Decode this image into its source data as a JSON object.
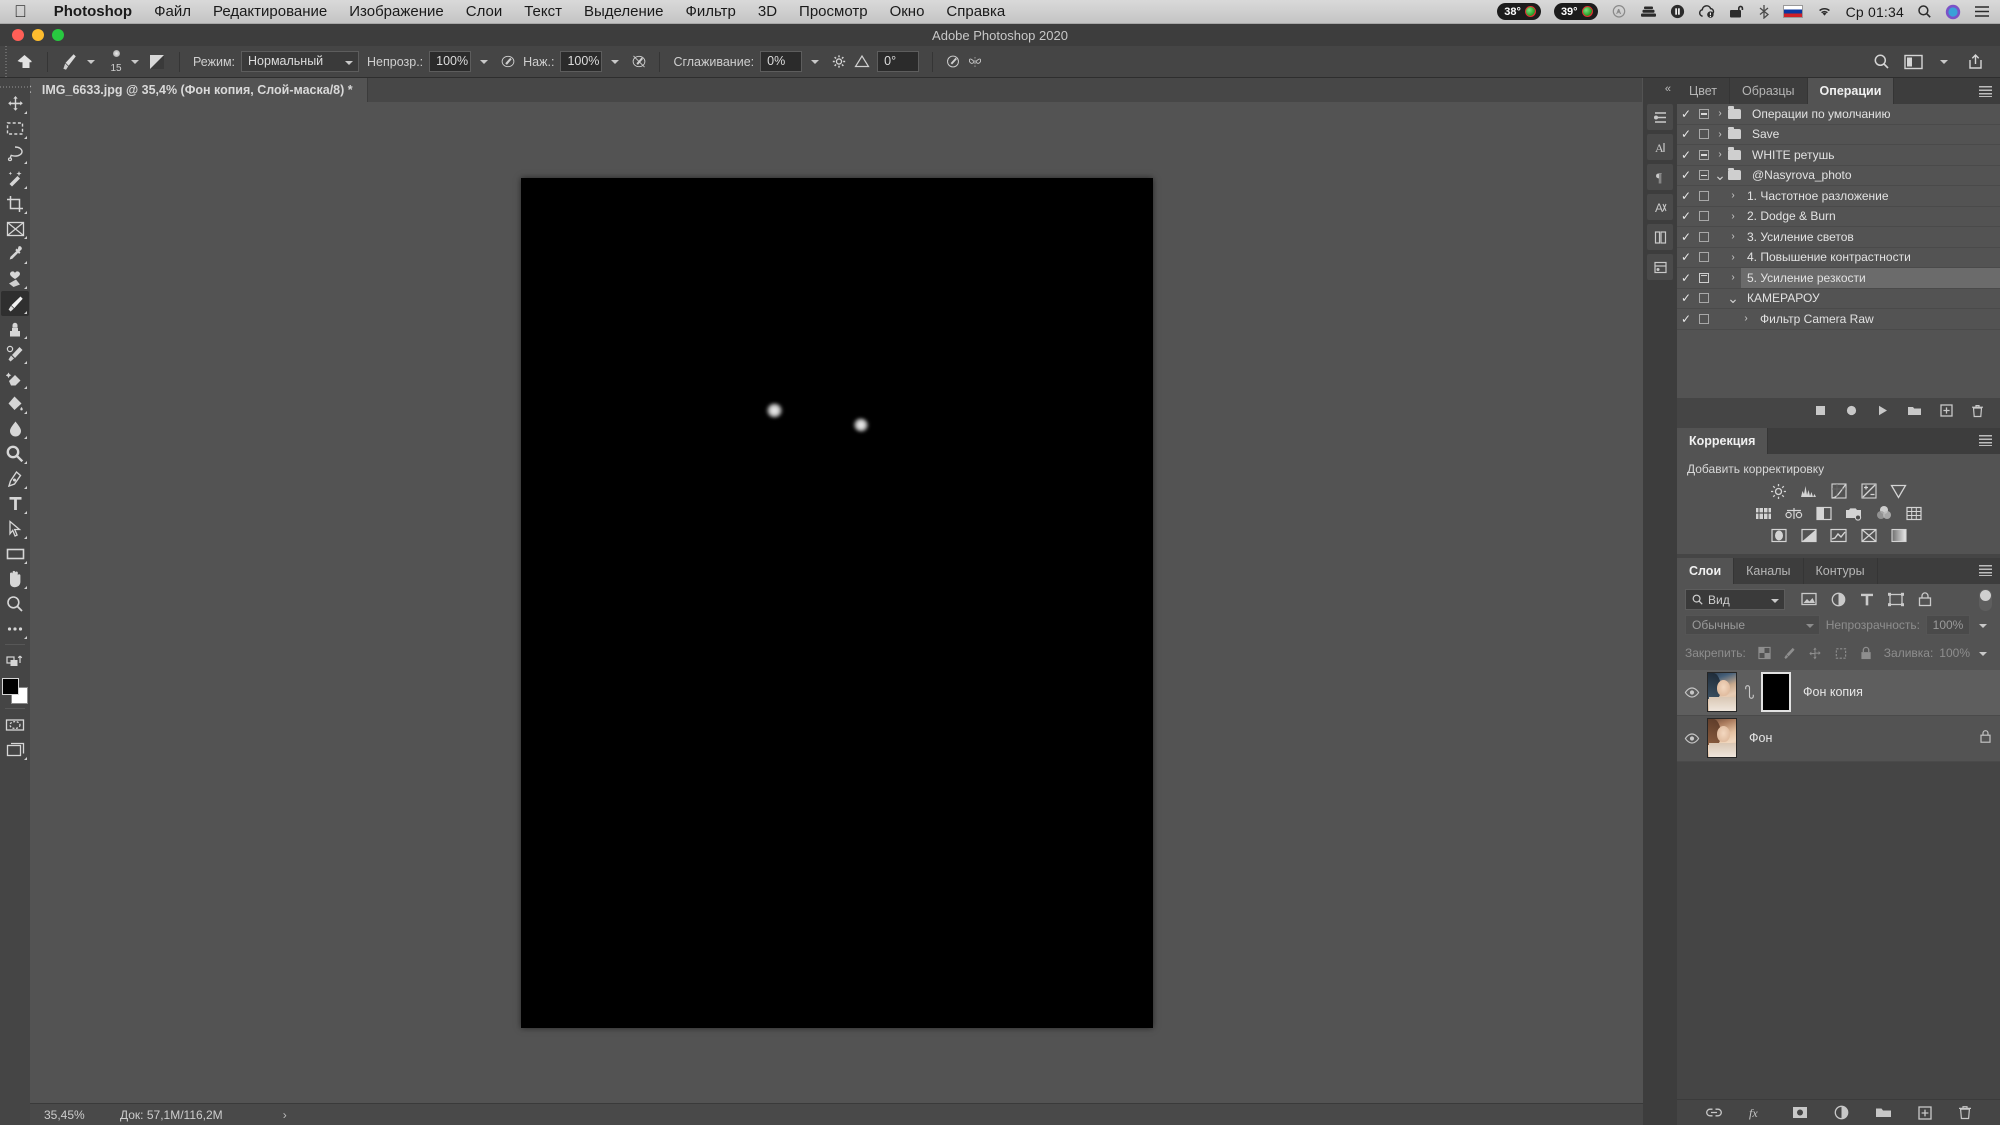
{
  "macmenu": {
    "apple_icon": "apple-logo-icon",
    "app_name": "Photoshop",
    "items": [
      "Файл",
      "Редактирование",
      "Изображение",
      "Слои",
      "Текст",
      "Выделение",
      "Фильтр",
      "3D",
      "Просмотр",
      "Окно",
      "Справка"
    ],
    "status": {
      "temp1": "38°",
      "temp2": "39°",
      "icons": [
        "creative-cloud-icon",
        "backup-icon",
        "dropbox-icon",
        "cloud-sync-icon",
        "vpn-icon",
        "bluetooth-icon"
      ],
      "flag": "russian-flag-icon",
      "wifi": "wifi-icon",
      "clock": "Ср 01:34",
      "search": "spotlight-search-icon",
      "siri": "siri-icon",
      "controlcenter": "notification-center-icon"
    }
  },
  "titlebar": {
    "title": "Adobe Photoshop 2020"
  },
  "options": {
    "home_icon": "home-icon",
    "brush_icon": "brush-tool-icon",
    "brush_size": "15",
    "brush_settings_icon": "brush-settings-icon",
    "mode_label": "Режим:",
    "mode_value": "Нормальный",
    "opacity_label": "Непрозр.:",
    "opacity_value": "100%",
    "opacity_pressure_icon": "pressure-opacity-icon",
    "flow_label": "Наж.:",
    "flow_value": "100%",
    "airbrush_icon": "airbrush-icon",
    "smoothing_label": "Сглаживание:",
    "smoothing_value": "0%",
    "smoothing_gear_icon": "gear-icon",
    "angle_icon": "brush-angle-icon",
    "angle_value": "0°",
    "pressure_size_icon": "pressure-size-icon",
    "symmetry_icon": "symmetry-butterfly-icon",
    "right_icons": [
      "search-icon",
      "workspace-icon",
      "share-icon"
    ]
  },
  "document": {
    "tab_title": "IMG_6633.jpg @ 35,4% (Фон копия, Слой-маска/8) *",
    "close_icon": "close-icon"
  },
  "tools": [
    {
      "name": "move-tool",
      "glyph": "move"
    },
    {
      "name": "marquee-tool",
      "glyph": "marquee"
    },
    {
      "name": "lasso-tool",
      "glyph": "lasso"
    },
    {
      "name": "quick-selection-tool",
      "glyph": "wand"
    },
    {
      "name": "crop-tool",
      "glyph": "crop"
    },
    {
      "name": "frame-tool",
      "glyph": "frame"
    },
    {
      "name": "eyedropper-tool",
      "glyph": "eyedropper"
    },
    {
      "name": "healing-brush-tool",
      "glyph": "healing"
    },
    {
      "name": "brush-tool",
      "glyph": "brush",
      "active": true
    },
    {
      "name": "clone-stamp-tool",
      "glyph": "stamp"
    },
    {
      "name": "history-brush-tool",
      "glyph": "historybrush"
    },
    {
      "name": "eraser-tool",
      "glyph": "eraser"
    },
    {
      "name": "gradient-tool",
      "glyph": "paintbucket"
    },
    {
      "name": "blur-tool",
      "glyph": "blur"
    },
    {
      "name": "dodge-tool",
      "glyph": "dodge"
    },
    {
      "name": "pen-tool",
      "glyph": "pen"
    },
    {
      "name": "type-tool",
      "glyph": "type"
    },
    {
      "name": "path-selection-tool",
      "glyph": "arrow"
    },
    {
      "name": "rectangle-tool",
      "glyph": "rect"
    },
    {
      "name": "hand-tool",
      "glyph": "hand"
    },
    {
      "name": "zoom-tool",
      "glyph": "zoom"
    },
    {
      "name": "edit-toolbar-button",
      "glyph": "dots"
    }
  ],
  "color_swatch": {
    "foreground": "#000000",
    "background": "#ffffff",
    "swap_icon": "swap-colors-icon",
    "default_icon": "default-colors-icon",
    "quickmask_icon": "quick-mask-icon",
    "screenmode_icon": "screen-mode-icon"
  },
  "canvas": {
    "background_color": "#000000",
    "highlights": [
      "eye-highlight-left",
      "eye-highlight-right"
    ]
  },
  "statusbar": {
    "zoom": "35,45%",
    "doc_info": "Док: 57,1M/116,2M",
    "arrow_icon": "chevron-right-icon"
  },
  "dockrail": {
    "collapse_icon": "collapse-panels-icon",
    "icons": [
      "history-panel-icon",
      "character-panel-icon",
      "paragraph-panel-icon",
      "glyphs-panel-icon",
      "libraries-panel-icon",
      "properties-panel-icon"
    ]
  },
  "actions_panel": {
    "tabs": [
      {
        "label": "Цвет",
        "active": false
      },
      {
        "label": "Образцы",
        "active": false
      },
      {
        "label": "Операции",
        "active": true
      }
    ],
    "menu_icon": "panel-menu-icon",
    "rows": [
      {
        "checked": true,
        "box": "minus",
        "twirl": "closed",
        "icon": "folder",
        "indent": 0,
        "label": "Операции по умолчанию",
        "selected": false
      },
      {
        "checked": true,
        "box": "empty",
        "twirl": "closed",
        "icon": "folder",
        "indent": 0,
        "label": "Save",
        "selected": false
      },
      {
        "checked": true,
        "box": "minus",
        "twirl": "closed",
        "icon": "folder",
        "indent": 0,
        "label": "WHITE  ретушь",
        "selected": false
      },
      {
        "checked": true,
        "box": "minus",
        "twirl": "open",
        "icon": "folder-open",
        "indent": 0,
        "label": "@Nasyrova_photo",
        "selected": false
      },
      {
        "checked": true,
        "box": "empty",
        "twirl": "closed",
        "icon": "none",
        "indent": 1,
        "label": "1. Частотное разложение",
        "selected": false
      },
      {
        "checked": true,
        "box": "empty",
        "twirl": "closed",
        "icon": "none",
        "indent": 1,
        "label": "2. Dodge & Burn",
        "selected": false
      },
      {
        "checked": true,
        "box": "empty",
        "twirl": "closed",
        "icon": "none",
        "indent": 1,
        "label": "3. Усиление светов",
        "selected": false
      },
      {
        "checked": true,
        "box": "empty",
        "twirl": "closed",
        "icon": "none",
        "indent": 1,
        "label": "4. Повышение контрастности",
        "selected": false
      },
      {
        "checked": true,
        "box": "hollow",
        "twirl": "closed",
        "icon": "none",
        "indent": 1,
        "label": "5. Усиление резкости",
        "selected": true
      },
      {
        "checked": true,
        "box": "empty",
        "twirl": "open",
        "icon": "none",
        "indent": 1,
        "label": "КАМЕРАРОУ",
        "selected": false
      },
      {
        "checked": true,
        "box": "empty",
        "twirl": "closed",
        "icon": "none",
        "indent": 2,
        "label": "Фильтр Camera Raw",
        "selected": false
      }
    ],
    "footer_icons": [
      "stop-icon",
      "record-icon",
      "play-icon",
      "new-set-icon",
      "new-action-icon",
      "delete-icon"
    ]
  },
  "corrections_panel": {
    "tab": "Коррекция",
    "menu_icon": "panel-menu-icon",
    "header": "Добавить корректировку",
    "row1": [
      "brightness-contrast-icon",
      "levels-icon",
      "curves-icon",
      "exposure-icon",
      "vibrance-icon"
    ],
    "row2": [
      "hue-saturation-icon",
      "color-balance-icon",
      "black-white-icon",
      "photo-filter-icon",
      "channel-mixer-icon",
      "color-lookup-icon"
    ],
    "row3": [
      "invert-icon",
      "posterize-icon",
      "threshold-icon",
      "selective-color-icon",
      "gradient-map-icon"
    ]
  },
  "layers_panel": {
    "tabs": [
      {
        "label": "Слои",
        "active": true
      },
      {
        "label": "Каналы",
        "active": false
      },
      {
        "label": "Контуры",
        "active": false
      }
    ],
    "menu_icon": "panel-menu-icon",
    "filter": {
      "search_icon": "search-icon",
      "value": "Вид",
      "type_icons": [
        "filter-pixel-icon",
        "filter-adjustment-icon",
        "filter-type-icon",
        "filter-shape-icon",
        "filter-smart-icon"
      ],
      "toggle_icon": "filter-toggle-switch"
    },
    "blend_mode": "Обычные",
    "opacity_label": "Непрозрачность:",
    "opacity_value": "100%",
    "lock_label": "Закрепить:",
    "lock_icons": [
      "lock-transparency-icon",
      "lock-image-icon",
      "lock-position-icon",
      "lock-artboard-icon",
      "lock-all-icon"
    ],
    "fill_label": "Заливка:",
    "fill_value": "100%",
    "layers": [
      {
        "name": "Фон копия",
        "visible": true,
        "selected": true,
        "has_mask": true,
        "mask_color": "#000000",
        "linked": true,
        "locked": false
      },
      {
        "name": "Фон",
        "visible": true,
        "selected": false,
        "has_mask": false,
        "linked": false,
        "locked": true
      }
    ],
    "footer_icons": [
      "link-layers-icon",
      "fx-icon",
      "add-mask-icon",
      "add-adjustment-icon",
      "new-group-icon",
      "new-layer-icon",
      "delete-layer-icon"
    ]
  }
}
